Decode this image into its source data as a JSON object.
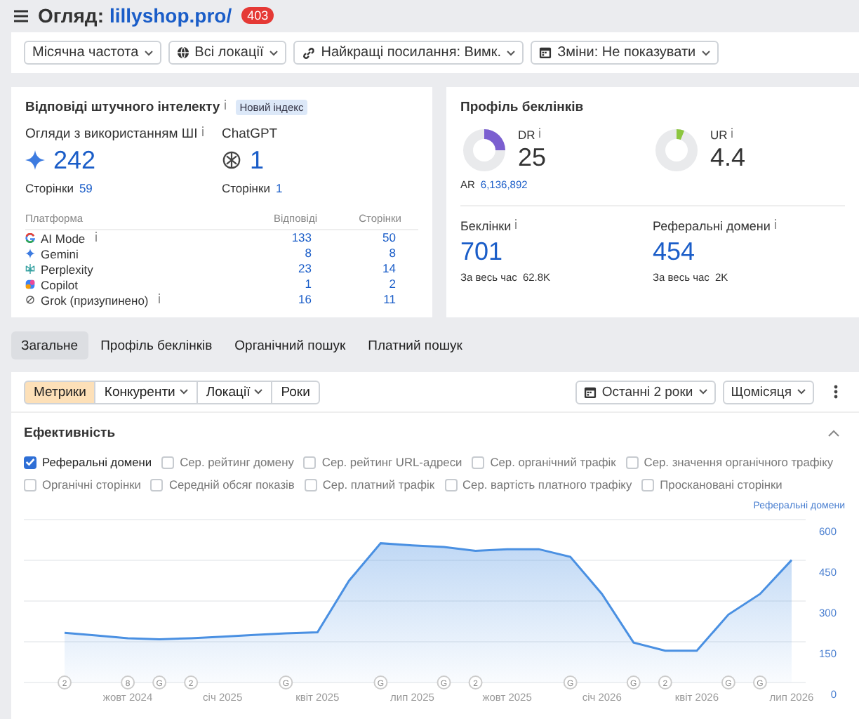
{
  "header": {
    "title": "Огляд:",
    "domain": "lillyshop.pro/",
    "badge": "403"
  },
  "filters": [
    {
      "label": "Місячна частота",
      "kind": "plain"
    },
    {
      "label": "Всі локації",
      "kind": "globe"
    },
    {
      "label": "Найкращі посилання: Вимк.",
      "kind": "link"
    },
    {
      "label": "Зміни: Не показувати",
      "kind": "calendar"
    }
  ],
  "ai_card": {
    "title": "Відповіді штучного інтелекту",
    "badge": "Новий індекс",
    "metrics": [
      {
        "label": "Огляди з використанням ШІ",
        "info": true,
        "kind": "sparkle",
        "value": "242",
        "sub_label": "Сторінки",
        "sub_value": "59"
      },
      {
        "label": "ChatGPT",
        "info": false,
        "kind": "chatgpt",
        "value": "1",
        "sub_label": "Сторінки",
        "sub_value": "1"
      }
    ],
    "columns": [
      "Платформа",
      "Відповіді",
      "Сторінки"
    ],
    "rows": [
      {
        "kind": "google",
        "name": "AI Mode",
        "info": true,
        "answers": "133",
        "pages": "50"
      },
      {
        "kind": "gemini",
        "name": "Gemini",
        "info": false,
        "answers": "8",
        "pages": "8"
      },
      {
        "kind": "perplexity",
        "name": "Perplexity",
        "info": false,
        "answers": "23",
        "pages": "14"
      },
      {
        "kind": "copilot",
        "name": "Copilot",
        "info": false,
        "answers": "1",
        "pages": "2"
      },
      {
        "kind": "grok",
        "name": "Grok (призупинено)",
        "info": true,
        "answers": "16",
        "pages": "11"
      }
    ]
  },
  "backlinks_card": {
    "title": "Профіль беклінків",
    "ratings": [
      {
        "label": "DR",
        "value": "25",
        "color": "#7b5fd0",
        "sub_label": "AR",
        "sub_value": "6,136,892"
      },
      {
        "label": "UR",
        "value": "4.4",
        "color": "#8cc63f"
      }
    ],
    "stats": [
      {
        "label": "Беклінки",
        "value": "701",
        "sub_label": "За весь час",
        "sub_value": "62.8K"
      },
      {
        "label": "Реферальні домени",
        "value": "454",
        "sub_label": "За весь час",
        "sub_value": "2K"
      }
    ]
  },
  "tabs": [
    {
      "label": "Загальне",
      "selected": true
    },
    {
      "label": "Профіль беклінків",
      "selected": false
    },
    {
      "label": "Органічний пошук",
      "selected": false
    },
    {
      "label": "Платний пошук",
      "selected": false
    }
  ],
  "toolbar": {
    "segments": [
      {
        "label": "Метрики",
        "selected": true,
        "dropdown": false
      },
      {
        "label": "Конкуренти",
        "selected": false,
        "dropdown": true
      },
      {
        "label": "Локації",
        "selected": false,
        "dropdown": true
      },
      {
        "label": "Роки",
        "selected": false,
        "dropdown": false
      }
    ],
    "period": "Останні 2 роки",
    "interval": "Щомісяця"
  },
  "performance": {
    "title": "Ефективність",
    "expanded": true,
    "metrics": [
      {
        "label": "Реферальні домени",
        "checked": true
      },
      {
        "label": "Сер. рейтинг домену",
        "checked": false
      },
      {
        "label": "Сер. рейтинг URL-адреси",
        "checked": false
      },
      {
        "label": "Сер. органічний трафік",
        "checked": false
      },
      {
        "label": "Сер. значення органічного трафіку",
        "checked": false
      },
      {
        "label": "Органічні сторінки",
        "checked": false
      },
      {
        "label": "Середній обсяг показів",
        "checked": false
      },
      {
        "label": "Сер. платний трафік",
        "checked": false
      },
      {
        "label": "Сер. вартість платного трафіку",
        "checked": false
      },
      {
        "label": "Просканованi сторінки",
        "checked": false
      }
    ],
    "chart_data": {
      "type": "area",
      "categories": [
        null,
        null,
        "жовт 2024",
        null,
        null,
        "січ 2025",
        null,
        null,
        "квіт 2025",
        null,
        null,
        "лип 2025",
        null,
        null,
        "жовт 2025",
        null,
        null,
        "січ 2026",
        null,
        null,
        "квіт 2026",
        null,
        null,
        "лип 2026"
      ],
      "series": [
        {
          "name": "Реферальні домени",
          "color": "#4a90e2",
          "values": [
            183,
            173,
            163,
            159,
            163,
            169,
            175,
            181,
            185,
            375,
            513,
            505,
            499,
            485,
            491,
            491,
            463,
            326,
            147,
            117,
            117,
            250,
            326,
            451
          ]
        }
      ],
      "ylim": [
        0,
        600
      ],
      "yticks": [
        0,
        150,
        300,
        450,
        600
      ],
      "grid": true
    },
    "event_markers": [
      {
        "kind": "event",
        "text": "2"
      },
      {
        "kind": "gap"
      },
      {
        "kind": "event",
        "text": "8"
      },
      {
        "kind": "event",
        "text": "G"
      },
      {
        "kind": "event",
        "text": "2"
      },
      {
        "kind": "gap"
      },
      {
        "kind": "gap"
      },
      {
        "kind": "event",
        "text": "G"
      },
      {
        "kind": "gap"
      },
      {
        "kind": "gap"
      },
      {
        "kind": "event",
        "text": "G"
      },
      {
        "kind": "gap"
      },
      {
        "kind": "event",
        "text": "G"
      },
      {
        "kind": "event",
        "text": "2"
      },
      {
        "kind": "gap"
      },
      {
        "kind": "gap"
      },
      {
        "kind": "event",
        "text": "G"
      },
      {
        "kind": "gap"
      },
      {
        "kind": "event",
        "text": "G"
      },
      {
        "kind": "event",
        "text": "2"
      },
      {
        "kind": "gap"
      },
      {
        "kind": "event",
        "text": "G"
      },
      {
        "kind": "event",
        "text": "G"
      },
      {
        "kind": "gap"
      }
    ]
  }
}
